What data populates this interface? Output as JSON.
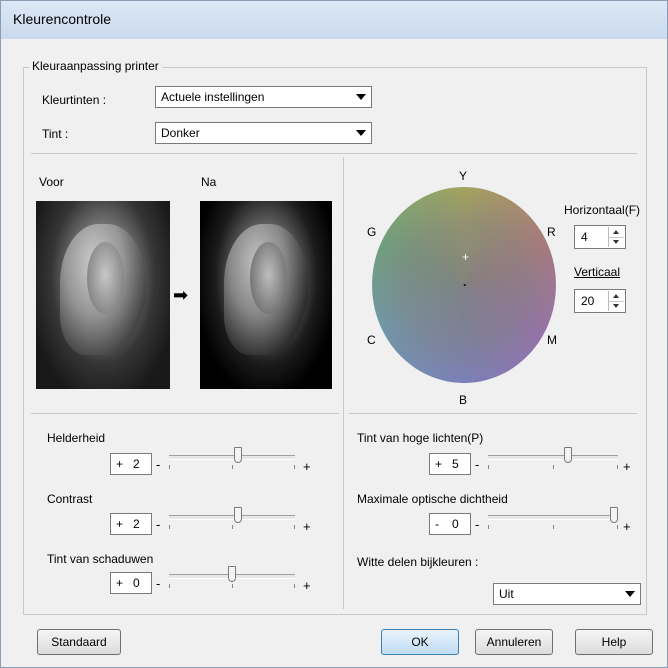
{
  "window": {
    "title": "Kleurencontrole"
  },
  "group": {
    "label": "Kleuraanpassing printer"
  },
  "kleurtinten": {
    "label": "Kleurtinten :",
    "value": "Actuele instellingen"
  },
  "tint": {
    "label": "Tint :",
    "value": "Donker"
  },
  "preview": {
    "before_label": "Voor",
    "after_label": "Na"
  },
  "wheel": {
    "labels": {
      "Y": "Y",
      "R": "R",
      "M": "M",
      "B": "B",
      "C": "C",
      "G": "G"
    },
    "crosshair": "+",
    "center_dot": "."
  },
  "horizontaal": {
    "label": "Horizontaal(F)",
    "value": "4"
  },
  "verticaal": {
    "label": "Verticaal",
    "value": "20"
  },
  "sliders": [
    {
      "label": "Helderheid",
      "sign": "+",
      "value": "2",
      "level": 0.55
    },
    {
      "label": "Contrast",
      "sign": "+",
      "value": "2",
      "level": 0.55
    },
    {
      "label": "Tint van schaduwen",
      "sign": "+",
      "value": "0",
      "level": 0.5
    },
    {
      "label": "Tint van hoge lichten(P)",
      "sign": "+",
      "value": "5",
      "level": 0.62
    },
    {
      "label": "Maximale optische dichtheid",
      "sign": "-",
      "value": "0",
      "level": 1.0
    }
  ],
  "minus": "-",
  "plus": "+",
  "witte": {
    "label": "Witte delen bijkleuren :",
    "value": "Uit"
  },
  "buttons": {
    "standaard": "Standaard",
    "ok": "OK",
    "annuleren": "Annuleren",
    "help": "Help"
  }
}
